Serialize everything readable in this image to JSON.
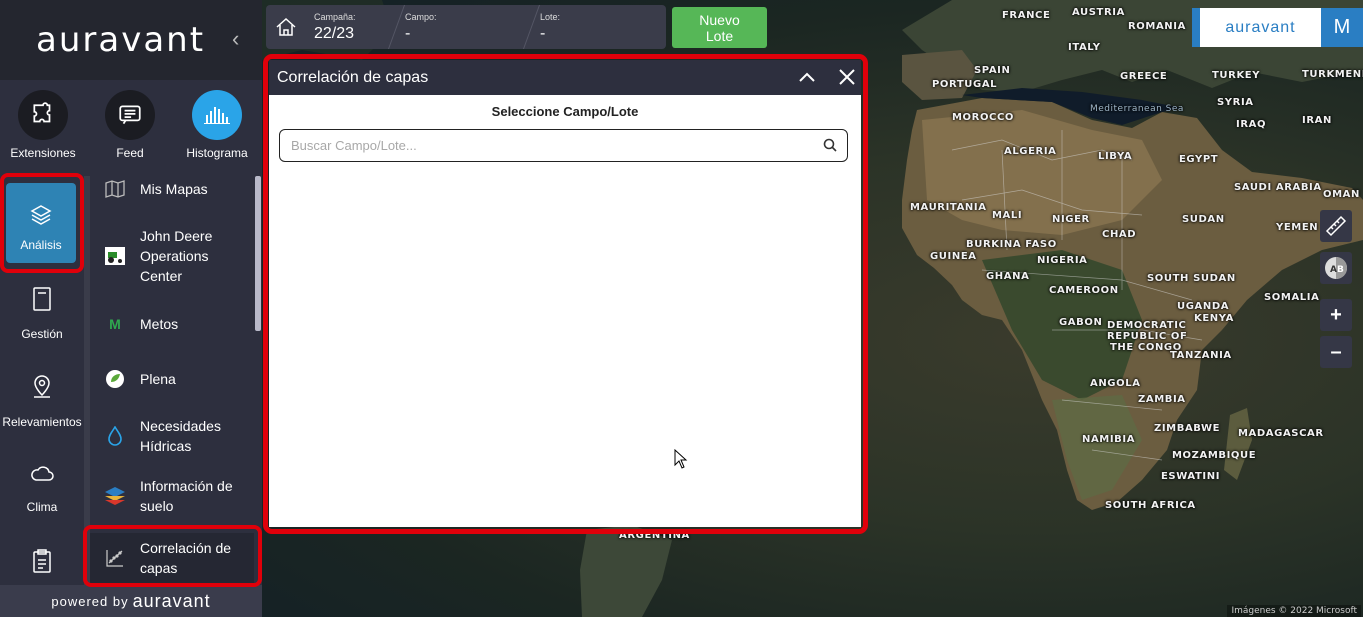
{
  "app": {
    "brand": "auravant",
    "powered_prefix": "powered by",
    "powered_brand": "auravant"
  },
  "extensions": [
    {
      "label": "Extensiones",
      "icon": "puzzle-icon"
    },
    {
      "label": "Feed",
      "icon": "feed-icon"
    },
    {
      "label": "Histograma",
      "icon": "histogram-icon",
      "active": true
    }
  ],
  "rail": [
    {
      "label": "Análisis",
      "icon": "layers-icon",
      "active": true
    },
    {
      "label": "Gestión",
      "icon": "notebook-icon"
    },
    {
      "label": "Relevamientos",
      "icon": "map-pin-icon"
    },
    {
      "label": "Clima",
      "icon": "cloud-icon"
    },
    {
      "label": "",
      "icon": "clipboard-icon"
    }
  ],
  "submenu": [
    {
      "label": "Mis Mapas",
      "icon": "map-icon"
    },
    {
      "label": "John Deere Operations Center",
      "icon": "tractor-icon"
    },
    {
      "label": "Metos",
      "icon": "metos-icon"
    },
    {
      "label": "Plena",
      "icon": "leaf-icon"
    },
    {
      "label": "Necesidades Hídricas",
      "icon": "water-drop-icon"
    },
    {
      "label": "Información de suelo",
      "icon": "soil-layers-icon"
    },
    {
      "label": "Correlación de capas",
      "icon": "correlation-icon",
      "selected": true
    }
  ],
  "topbar": {
    "campaign_key": "Campaña:",
    "campaign_value": "22/23",
    "field_key": "Campo:",
    "field_value": "-",
    "lot_key": "Lote:",
    "lot_value": "-",
    "new_lot_label": "Nuevo Lote"
  },
  "badge": {
    "brand": "auravant",
    "avatar_initial": "M"
  },
  "panel": {
    "title": "Correlación de capas",
    "subtitle": "Seleccione Campo/Lote",
    "search_placeholder": "Buscar Campo/Lote..."
  },
  "map": {
    "attribution": "Imágenes © 2022 Microsoft",
    "labels": [
      "FRANCE",
      "AUSTRIA",
      "ROMANIA",
      "ITALY",
      "SPAIN",
      "PORTUGAL",
      "GREECE",
      "TURKEY",
      "TURKMENIS",
      "MOROCCO",
      "Mediterranean Sea",
      "SYRIA",
      "IRAQ",
      "IRAN",
      "ALGERIA",
      "LIBYA",
      "EGYPT",
      "SAUDI ARABIA",
      "OMAN",
      "MAURITANIA",
      "MALI",
      "NIGER",
      "CHAD",
      "SUDAN",
      "YEMEN",
      "BURKINA FASO",
      "GUINEA",
      "NIGERIA",
      "GHANA",
      "SOUTH SUDAN",
      "CAMEROON",
      "UGANDA",
      "KENYA",
      "SOMALIA",
      "GABON",
      "DEMOCRATIC",
      "REPUBLIC OF",
      "THE CONGO",
      "TANZANIA",
      "ANGOLA",
      "ZAMBIA",
      "MADAGASCAR",
      "NAMIBIA",
      "ZIMBABWE",
      "MOZAMBIQUE",
      "ESWATINI",
      "SOUTH AFRICA",
      "ARGENTINA"
    ]
  },
  "colors": {
    "accent": "#2aa4e8",
    "highlight": "#e0000a",
    "new_lot": "#56b757",
    "sidebar": "#2d2f3e"
  }
}
